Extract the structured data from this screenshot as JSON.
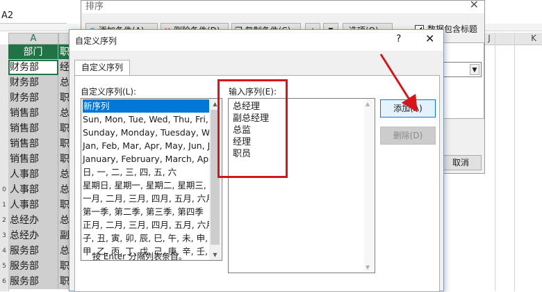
{
  "excel": {
    "name_box": "A2",
    "column_a_header": "A",
    "column_j_header": "J",
    "column_k_header": "K",
    "header_row": {
      "a": "部门",
      "b": "职"
    },
    "rows": [
      {
        "a": "财务部",
        "b": "经"
      },
      {
        "a": "财务部",
        "b": "总"
      },
      {
        "a": "财务部",
        "b": "职"
      },
      {
        "a": "销售部",
        "b": "总"
      },
      {
        "a": "销售部",
        "b": "职"
      },
      {
        "a": "销售部",
        "b": "职"
      },
      {
        "a": "销售部",
        "b": "职"
      },
      {
        "a": "人事部",
        "b": "总"
      },
      {
        "a": "人事部",
        "b": "总"
      },
      {
        "a": "人事部",
        "b": "职"
      },
      {
        "a": "总经办",
        "b": "总"
      },
      {
        "a": "总经办",
        "b": "副"
      },
      {
        "a": "服务部",
        "b": "总"
      },
      {
        "a": "服务部",
        "b": "职"
      },
      {
        "a": "服务部",
        "b": "职"
      }
    ],
    "row_numbers": [
      "",
      "",
      "",
      "",
      "",
      "",
      "",
      "",
      "",
      "0",
      "1",
      "2",
      "3",
      "4",
      "5",
      "6"
    ]
  },
  "sort_dialog": {
    "title": "排序",
    "close_glyph": "✕",
    "add_level": "添加条件(A)",
    "delete_level": "删除条件(D)",
    "copy_level": "复制条件(C)",
    "move_up": "▲",
    "move_down": "▼",
    "options": "选项(O)...",
    "header_checkbox": "数据包含标题(H)",
    "cancel": "取消"
  },
  "custom_list_dialog": {
    "title": "自定义序列",
    "help_glyph": "?",
    "close_glyph": "✕",
    "tab": "自定义序列",
    "lists_label": "自定义序列(L):",
    "entries_label": "输入序列(E):",
    "lists": [
      "新序列",
      "Sun, Mon, Tue, Wed, Thu, Fri, S",
      "Sunday, Monday, Tuesday, Wed",
      "Jan, Feb, Mar, Apr, May, Jun, Ju",
      "January, February, March, April",
      "日, 一, 二, 三, 四, 五, 六",
      "星期日, 星期一, 星期二, 星期三, 星",
      "一月, 二月, 三月, 四月, 五月, 六月,",
      "第一季, 第二季, 第三季, 第四季",
      "正月, 二月, 三月, 四月, 五月, 六月,",
      "子, 丑, 寅, 卯, 辰, 巳, 午, 未, 申, 酉",
      "甲, 乙, 丙, 丁, 戊, 己, 庚, 辛, 壬, 癸"
    ],
    "selected_index": 0,
    "entries": [
      "总经理",
      "副总经理",
      "总监",
      "经理",
      "职员"
    ],
    "add_button": "添加(A)",
    "delete_button": "删除(D)",
    "hint": "按 Enter 分隔列表条目。"
  },
  "annotation": {
    "color": "#d4161a"
  },
  "colors": {
    "excel_green": "#217346",
    "selection_blue": "#0078d7"
  }
}
